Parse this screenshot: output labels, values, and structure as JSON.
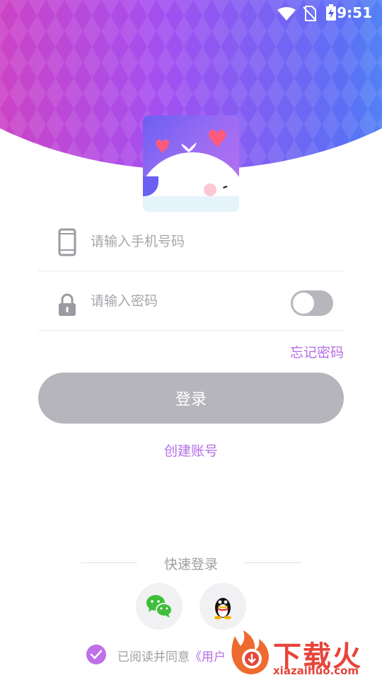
{
  "status_bar": {
    "time": "9:51",
    "icons": [
      "wifi-icon",
      "no-sim-icon",
      "battery-charging-icon"
    ]
  },
  "login_form": {
    "phone": {
      "placeholder": "请输入手机号码",
      "value": "",
      "icon": "phone-icon"
    },
    "password": {
      "placeholder": "请输入密码",
      "value": "",
      "icon": "lock-icon",
      "visibility_toggle_on": false
    },
    "forgot_label": "忘记密码",
    "login_label": "登录",
    "create_label": "创建账号"
  },
  "quick_login": {
    "label": "快速登录",
    "providers": [
      {
        "icon": "wechat-icon"
      },
      {
        "icon": "qq-icon"
      }
    ]
  },
  "agreement": {
    "prefix": "已阅读并同意",
    "link": "《用户",
    "checked": true
  },
  "watermark": {
    "brand": "下载火",
    "domain": "xiazaihuo.com"
  },
  "colors": {
    "accent": "#b56ee6",
    "button_disabled": "#b6b5bb",
    "gradient": [
      "#e93ba7",
      "#a44ff0",
      "#5b6ff5",
      "#35c4ee"
    ]
  }
}
